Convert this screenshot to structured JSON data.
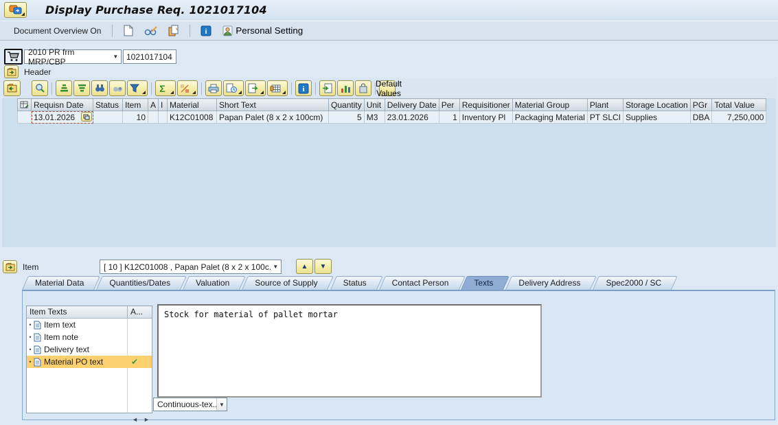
{
  "title_bar": {
    "title": "Display Purchase Req. 1021017104"
  },
  "app_toolbar": {
    "document_overview_label": "Document Overview On",
    "personal_setting_label": "Personal Setting"
  },
  "pr_selector": {
    "document_type": "2010 PR frm MRP/CBP",
    "document_number": "1021017104"
  },
  "header_section": {
    "label": "Header"
  },
  "items_grid": {
    "default_values_label": "Default Values",
    "columns": [
      "Requisn Date",
      "Status",
      "Item",
      "A",
      "I",
      "Material",
      "Short Text",
      "Quantity",
      "Unit",
      "Delivery Date",
      "Per",
      "Requisitioner",
      "Material Group",
      "Plant",
      "Storage Location",
      "PGr",
      "Total Value"
    ],
    "row": {
      "requisn_date": "13.01.2026",
      "status": "",
      "item": "10",
      "a": "",
      "i": "",
      "material": "K12C01008",
      "short_text": "Papan Palet (8 x 2 x 100cm)",
      "quantity": "5",
      "unit": "M3",
      "delivery_date": "23.01.2026",
      "per": "1",
      "requisitioner": "Inventory Pl",
      "material_group": "Packaging Material",
      "plant": "PT SLCI",
      "storage_location": "Supplies",
      "pgr": "DBA",
      "total_value": "7,250,000"
    }
  },
  "item_section": {
    "label": "Item",
    "selected_item": "[ 10 ] K12C01008 , Papan Palet (8 x 2 x 100c...",
    "tabs": [
      {
        "label": "Material Data"
      },
      {
        "label": "Quantities/Dates"
      },
      {
        "label": "Valuation"
      },
      {
        "label": "Source of Supply"
      },
      {
        "label": "Status"
      },
      {
        "label": "Contact Person"
      },
      {
        "label": "Texts",
        "active": true
      },
      {
        "label": "Delivery Address"
      },
      {
        "label": "Spec2000 / SC"
      }
    ]
  },
  "texts_tab": {
    "list_title": "Item Texts",
    "status_column_title": "A...",
    "text_types": [
      {
        "label": "Item text",
        "adopted": false
      },
      {
        "label": "Item note",
        "adopted": false
      },
      {
        "label": "Delivery text",
        "adopted": false
      },
      {
        "label": "Material PO text",
        "adopted": true,
        "selected": true
      }
    ],
    "editor_text": "Stock for material of pallet mortar",
    "format_dropdown": "Continuous-tex..."
  },
  "icons": {
    "dropdown_arrow": "▼",
    "up_arrow": "▲",
    "down_arrow": "▼",
    "left_arrow": "◄",
    "right_arrow": "►",
    "checkmark": "✔",
    "bullet": "•",
    "sum_glyph": "Σ",
    "percent_glyph": "%",
    "info_glyph": "i"
  },
  "colors": {
    "accent_button": "#f4eca4",
    "selected_cell": "#f6eeae",
    "selected_row_highlight": "#fcd06e",
    "active_tab": "#8fadd4",
    "grid_empty_bg": "#cddeec",
    "check_green": "#2f9e44"
  }
}
